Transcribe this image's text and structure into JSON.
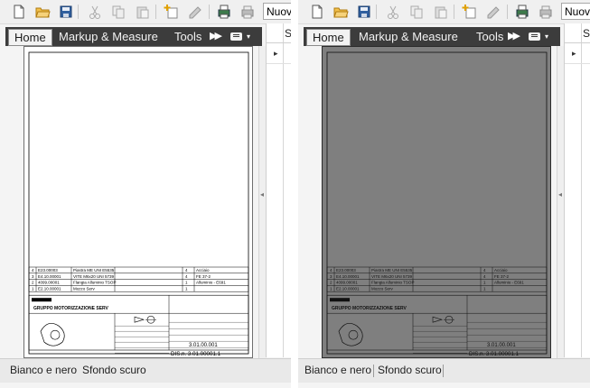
{
  "toolbar": {
    "icons": [
      "new-document-icon",
      "open-folder-icon",
      "save-icon",
      "cut-icon",
      "copy-icon",
      "paste-icon",
      "add-sheet-icon",
      "edit-markup-icon",
      "print-preview-icon",
      "print-icon"
    ],
    "dropdown_value": "Nuov"
  },
  "ribbon": {
    "tabs": [
      {
        "label": "Home",
        "active": true
      },
      {
        "label": "Markup & Measure",
        "active": false
      },
      {
        "label": "Tools",
        "active": false
      }
    ],
    "overflow_glyph": "▶▶",
    "menu_glyph": "▾"
  },
  "side_panel": {
    "header": "S",
    "arrow": "▸"
  },
  "drawing": {
    "parts": [
      {
        "n": "4",
        "code": "E23.00003",
        "desc": "Piastra ME UNI E5535",
        "qty": "4",
        "mat": "Acciaio"
      },
      {
        "n": "3",
        "code": "E4.10.00001",
        "desc": "VITE M6x20 UNI 5739",
        "qty": "4",
        "mat": "FE 37-2"
      },
      {
        "n": "2",
        "code": "4099.00001",
        "desc": "Flangia Alluminio TSOP",
        "qty": "1",
        "mat": "Alluminio - E691"
      },
      {
        "n": "1",
        "code": "E2.10.00001",
        "desc": "Mozzo Serv",
        "qty": "1",
        "mat": ""
      }
    ],
    "title": "GRUPPO MOTORIZZAZIONE SERV",
    "drawing_number": "DIS.n. 3.01.00001.1",
    "code": "3.01.00.001"
  },
  "statusbar": {
    "tabs": [
      "Bianco e nero",
      "Sfondo scuro"
    ]
  },
  "colors": {
    "ribbon_bg": "#3c3c3c",
    "sheet_light": "#ffffff",
    "sheet_dark": "#7f7f7f"
  }
}
